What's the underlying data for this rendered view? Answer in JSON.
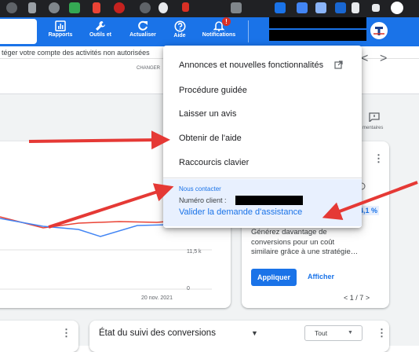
{
  "toolbar": {
    "rapports": "Rapports",
    "outils": "Outils et",
    "actualiser": "Actualiser",
    "aide": "Aide",
    "notifications": "Notifications",
    "notif_badge": "!"
  },
  "notice": {
    "text": "téger votre compte des activités non autorisées"
  },
  "header": {
    "changer": "CHANGER",
    "prev_chevron": "<",
    "next_chevron": ">",
    "comments_label": "mentaires"
  },
  "help_menu": {
    "items": [
      {
        "label": "Annonces et nouvelles fonctionnalités"
      },
      {
        "label": "Procédure guidée"
      },
      {
        "label": "Laisser un avis"
      },
      {
        "label": "Obtenir de l'aide"
      },
      {
        "label": "Raccourcis clavier"
      }
    ],
    "contact_header": "Nous contacter",
    "client_label": "Numéro client :",
    "validate_link": "Valider la demande d'assistance"
  },
  "chart_card": {
    "y_label_mid": "11,5 k",
    "y_label_zero": "0",
    "date_label": "20 nov. 2021",
    "series_colors": [
      "#ea4335",
      "#4285f4"
    ]
  },
  "reco_card": {
    "percent": "4,1 %",
    "text_lines": [
      "Générez davantage de",
      "conversions pour un coût",
      "similaire grâce à une stratégie…"
    ],
    "apply_button": "Appliquer",
    "view_button": "Afficher",
    "pager": "1 / 7",
    "pager_prev": "<",
    "pager_next": ">"
  },
  "conversions_card": {
    "title": "État du suivi des conversions",
    "select_value": "Tout"
  }
}
